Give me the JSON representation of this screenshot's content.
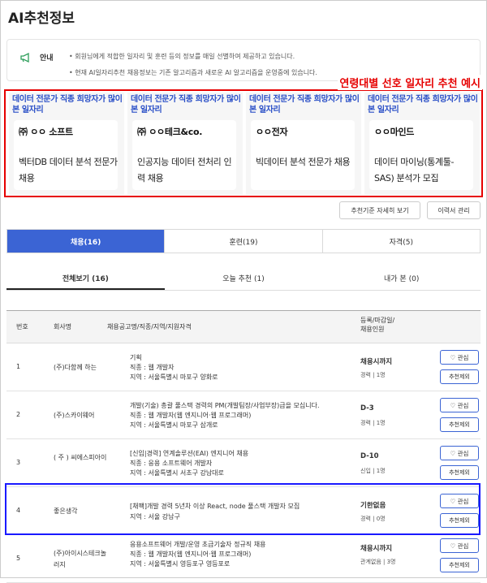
{
  "page_title": "AI추천정보",
  "notice": {
    "label": "안내",
    "lines": [
      "• 회원님에게 적합한 일자리 및 훈련 등의 정보를 매일 선별하여 제공하고 있습니다.",
      "• 현재 AI일자리추천 채용정보는 기존 알고리즘과 새로운 AI 알고리즘을 운영중에 있습니다."
    ]
  },
  "highlight_title": "연령대별 선호 일자리 추천 예시",
  "cards": [
    {
      "head": "데이터 전문가 직종 희망자가 많이 본 일자리",
      "company": "㈜ ㅇㅇ 소프트",
      "job": "벡터DB 데이터 분석 전문가 채용"
    },
    {
      "head": "데이터 전문가 직종 희망자가 많이 본 일자리",
      "company": "㈜ ㅇㅇ테크&co.",
      "job": "인공지능 데이터 전처리 인력 채용"
    },
    {
      "head": "데이터 전문가 직종 희망자가 많이 본 일자리",
      "company": "ㅇㅇ전자",
      "job": "빅데이터 분석 전문가 채용"
    },
    {
      "head": "데이터 전문가 직종 희망자가 많이 본 일자리",
      "company": "ㅇㅇ마인드",
      "job": "데이터 마이닝(통계툴-SAS) 분석가 모집"
    }
  ],
  "buttons": {
    "detail": "추천기준 자세히 보기",
    "resume": "이력서 관리"
  },
  "tabs": [
    "채용(16)",
    "훈련(19)",
    "자격(5)"
  ],
  "subtabs": [
    "전체보기 (16)",
    "오늘 추천 (1)",
    "내가 본 (0)"
  ],
  "table": {
    "headers": {
      "no": "번호",
      "company": "회사명",
      "info": "채용공고명/직종/지역/지원자격",
      "reg": "등록/마감일/\n채용인원"
    },
    "like_label": "♡ 관심",
    "remove_label": "추천제외",
    "rows": [
      {
        "no": "1",
        "company": "(주)다함께 하는",
        "info": [
          "기획",
          "직종 : 웹 개발자",
          "지역 : 서울특별시 마포구 양화로"
        ],
        "deadline": "채용시까지",
        "meta": "경력   |   1명"
      },
      {
        "no": "2",
        "company": "(주)스카이웨어",
        "info": [
          "개발(기술) 총괄 풀스택 경력의 PM(개발팀장/사업부장)급을 모십니다.",
          "직종 : 웹 개발자(웹 엔지니어·웹 프로그래머)",
          "지역 : 서울특별시 마포구 삼개로"
        ],
        "deadline": "D-3",
        "meta": "경력   |   1명"
      },
      {
        "no": "3",
        "company": "( 주 ) 씨에스피아이",
        "info": [
          "[신입|경력] 연계솔루션(EAI) 엔지니어 채용",
          "직종 : 응용 소프트웨어 개발자",
          "지역 : 서울특별시 서초구 강남대로"
        ],
        "deadline": "D-10",
        "meta": "신입   |   1명"
      },
      {
        "no": "4",
        "company": "좋은생각",
        "info": [
          "[채팩]개발 경력 5년차 이상 React, node 풀스택 개발자 모집",
          "지역 : 서울 강남구"
        ],
        "deadline": "기한없음",
        "meta": "경력   |   0명"
      },
      {
        "no": "5",
        "company": "(주)아이시스테크놀러지",
        "info": [
          "응용소프트웨어 개발/운영 초급기술자 정규직 채용",
          "직종 : 웹 개발자(웹 엔지니어·웹 프로그래머)",
          "지역 : 서울특별시 영등포구 영등포로"
        ],
        "deadline": "채용시까지",
        "meta": "관계없음   |   3명"
      }
    ]
  },
  "colors": {
    "accent": "#3b64d4",
    "highlight_red": "#e60000",
    "highlight_blue": "#1a1aff",
    "card_head": "#2a4fc7"
  }
}
